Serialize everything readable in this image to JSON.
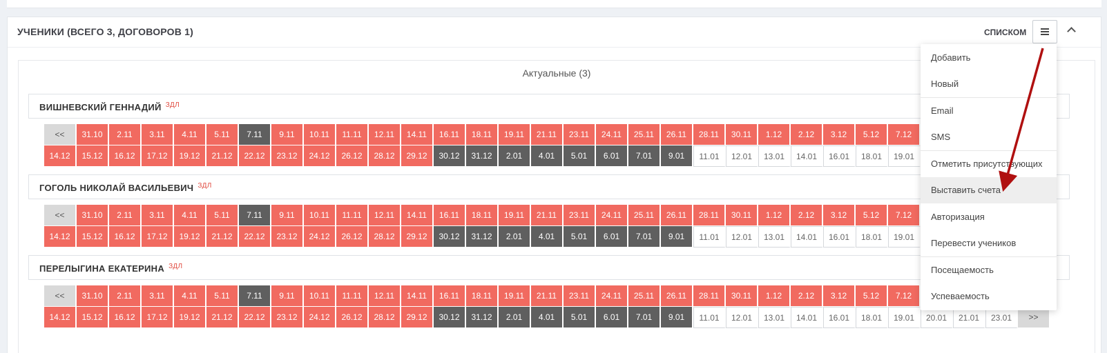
{
  "portlet": {
    "title": "УЧЕНИКИ (ВСЕГО 3, ДОГОВОРОВ 1)",
    "view_label": "СПИСКОМ"
  },
  "section_title": "Актуальные (3)",
  "students": [
    {
      "name": "ВИШНЕВСКИЙ ГЕННАДИЙ",
      "tag": "ЗДЛ"
    },
    {
      "name": "ГОГОЛЬ НИКОЛАЙ ВАСИЛЬЕВИЧ",
      "tag": "ЗДЛ"
    },
    {
      "name": "ПЕРЕЛЫГИНА ЕКАТЕРИНА",
      "tag": "ЗДЛ"
    }
  ],
  "calendar": {
    "prev": "<<",
    "next": ">>",
    "row1": [
      {
        "d": "31.10",
        "s": "red"
      },
      {
        "d": "2.11",
        "s": "red"
      },
      {
        "d": "3.11",
        "s": "red"
      },
      {
        "d": "4.11",
        "s": "red"
      },
      {
        "d": "5.11",
        "s": "red"
      },
      {
        "d": "7.11",
        "s": "dark"
      },
      {
        "d": "9.11",
        "s": "red"
      },
      {
        "d": "10.11",
        "s": "red"
      },
      {
        "d": "11.11",
        "s": "red"
      },
      {
        "d": "12.11",
        "s": "red"
      },
      {
        "d": "14.11",
        "s": "red"
      },
      {
        "d": "16.11",
        "s": "red"
      },
      {
        "d": "18.11",
        "s": "red"
      },
      {
        "d": "19.11",
        "s": "red"
      },
      {
        "d": "21.11",
        "s": "red"
      },
      {
        "d": "23.11",
        "s": "red"
      },
      {
        "d": "24.11",
        "s": "red"
      },
      {
        "d": "25.11",
        "s": "red"
      },
      {
        "d": "26.11",
        "s": "red"
      },
      {
        "d": "28.11",
        "s": "red"
      },
      {
        "d": "30.11",
        "s": "red"
      },
      {
        "d": "1.12",
        "s": "red"
      },
      {
        "d": "2.12",
        "s": "red"
      },
      {
        "d": "3.12",
        "s": "red"
      },
      {
        "d": "5.12",
        "s": "red"
      },
      {
        "d": "7.12",
        "s": "red"
      },
      {
        "d": "",
        "s": "red"
      },
      {
        "d": "",
        "s": "red"
      },
      {
        "d": "",
        "s": "red"
      },
      {
        "d": "",
        "s": "red"
      }
    ],
    "row2": [
      {
        "d": "14.12",
        "s": "red"
      },
      {
        "d": "15.12",
        "s": "red"
      },
      {
        "d": "16.12",
        "s": "red"
      },
      {
        "d": "17.12",
        "s": "red"
      },
      {
        "d": "19.12",
        "s": "red"
      },
      {
        "d": "21.12",
        "s": "red"
      },
      {
        "d": "22.12",
        "s": "red"
      },
      {
        "d": "23.12",
        "s": "red"
      },
      {
        "d": "24.12",
        "s": "red"
      },
      {
        "d": "26.12",
        "s": "red"
      },
      {
        "d": "28.12",
        "s": "red"
      },
      {
        "d": "29.12",
        "s": "red"
      },
      {
        "d": "30.12",
        "s": "dark"
      },
      {
        "d": "31.12",
        "s": "dark"
      },
      {
        "d": "2.01",
        "s": "dark"
      },
      {
        "d": "4.01",
        "s": "dark"
      },
      {
        "d": "5.01",
        "s": "dark"
      },
      {
        "d": "6.01",
        "s": "dark"
      },
      {
        "d": "7.01",
        "s": "dark"
      },
      {
        "d": "9.01",
        "s": "dark"
      },
      {
        "d": "11.01",
        "s": "empty"
      },
      {
        "d": "12.01",
        "s": "empty"
      },
      {
        "d": "13.01",
        "s": "empty"
      },
      {
        "d": "14.01",
        "s": "empty"
      },
      {
        "d": "16.01",
        "s": "empty"
      },
      {
        "d": "18.01",
        "s": "empty"
      },
      {
        "d": "19.01",
        "s": "empty"
      },
      {
        "d": "20.01",
        "s": "empty"
      },
      {
        "d": "21.01",
        "s": "empty"
      },
      {
        "d": "23.01",
        "s": "empty"
      }
    ]
  },
  "dropdown": {
    "items": [
      {
        "label": "Добавить",
        "sep": false,
        "active": false
      },
      {
        "label": "Новый",
        "sep": false,
        "active": false
      },
      {
        "label": "Email",
        "sep": true,
        "active": false
      },
      {
        "label": "SMS",
        "sep": false,
        "active": false
      },
      {
        "label": "Отметить присутствующих",
        "sep": true,
        "active": false
      },
      {
        "label": "Выставить счета",
        "sep": false,
        "active": true
      },
      {
        "label": "Авторизация",
        "sep": false,
        "active": false
      },
      {
        "label": "Перевести учеников",
        "sep": false,
        "active": false
      },
      {
        "label": "Посещаемость",
        "sep": true,
        "active": false
      },
      {
        "label": "Успеваемость",
        "sep": false,
        "active": false
      }
    ]
  },
  "colors": {
    "paid": "#f16a60",
    "past": "#5f5f5f",
    "arrow": "#b01010"
  }
}
